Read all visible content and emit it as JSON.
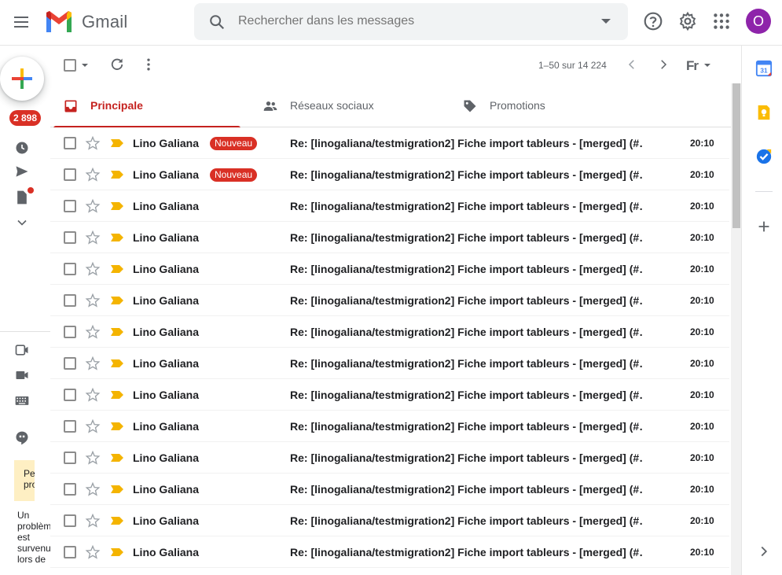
{
  "app": {
    "name": "Gmail"
  },
  "search": {
    "placeholder": "Rechercher dans les messages"
  },
  "user": {
    "avatar_letter": "O",
    "avatar_color": "#8e24aa"
  },
  "leftnav": {
    "inbox_badge": "2 898"
  },
  "note": {
    "title": "Petit problè",
    "body": "Un problème est survenu lors de"
  },
  "toolbar": {
    "pagination": "1–50 sur 14 224",
    "input_tool": "Fr"
  },
  "tabs": [
    {
      "label": "Principale",
      "active": true
    },
    {
      "label": "Réseaux sociaux",
      "active": false
    },
    {
      "label": "Promotions",
      "active": false
    }
  ],
  "new_label": "Nouveau",
  "emails": [
    {
      "sender": "Lino Galiana",
      "new": true,
      "subject": "Re: [linogaliana/testmigration2] Fiche import tableurs - [merged] (#…",
      "time": "20:10"
    },
    {
      "sender": "Lino Galiana",
      "new": true,
      "subject": "Re: [linogaliana/testmigration2] Fiche import tableurs - [merged] (#…",
      "time": "20:10"
    },
    {
      "sender": "Lino Galiana",
      "new": false,
      "subject": "Re: [linogaliana/testmigration2] Fiche import tableurs - [merged] (#…",
      "time": "20:10"
    },
    {
      "sender": "Lino Galiana",
      "new": false,
      "subject": "Re: [linogaliana/testmigration2] Fiche import tableurs - [merged] (#…",
      "time": "20:10"
    },
    {
      "sender": "Lino Galiana",
      "new": false,
      "subject": "Re: [linogaliana/testmigration2] Fiche import tableurs - [merged] (#…",
      "time": "20:10"
    },
    {
      "sender": "Lino Galiana",
      "new": false,
      "subject": "Re: [linogaliana/testmigration2] Fiche import tableurs - [merged] (#…",
      "time": "20:10"
    },
    {
      "sender": "Lino Galiana",
      "new": false,
      "subject": "Re: [linogaliana/testmigration2] Fiche import tableurs - [merged] (#…",
      "time": "20:10"
    },
    {
      "sender": "Lino Galiana",
      "new": false,
      "subject": "Re: [linogaliana/testmigration2] Fiche import tableurs - [merged] (#…",
      "time": "20:10"
    },
    {
      "sender": "Lino Galiana",
      "new": false,
      "subject": "Re: [linogaliana/testmigration2] Fiche import tableurs - [merged] (#…",
      "time": "20:10"
    },
    {
      "sender": "Lino Galiana",
      "new": false,
      "subject": "Re: [linogaliana/testmigration2] Fiche import tableurs - [merged] (#…",
      "time": "20:10"
    },
    {
      "sender": "Lino Galiana",
      "new": false,
      "subject": "Re: [linogaliana/testmigration2] Fiche import tableurs - [merged] (#…",
      "time": "20:10"
    },
    {
      "sender": "Lino Galiana",
      "new": false,
      "subject": "Re: [linogaliana/testmigration2] Fiche import tableurs - [merged] (#…",
      "time": "20:10"
    },
    {
      "sender": "Lino Galiana",
      "new": false,
      "subject": "Re: [linogaliana/testmigration2] Fiche import tableurs - [merged] (#…",
      "time": "20:10"
    },
    {
      "sender": "Lino Galiana",
      "new": false,
      "subject": "Re: [linogaliana/testmigration2] Fiche import tableurs - [merged] (#…",
      "time": "20:10"
    }
  ],
  "colors": {
    "accent": "#c5221f",
    "badge": "#d93025",
    "important": "#f4b400"
  }
}
